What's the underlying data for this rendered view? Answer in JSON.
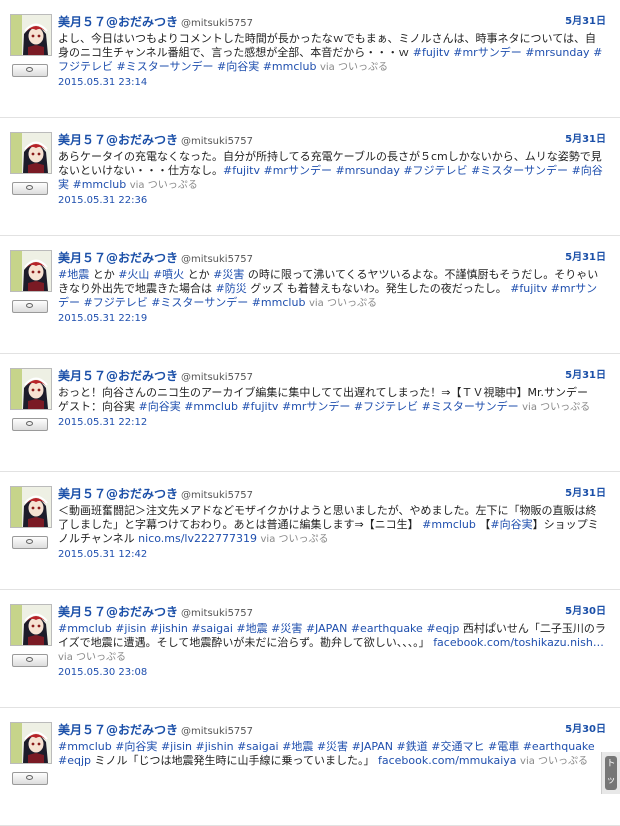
{
  "user": {
    "name": "美月５７@おだみつき",
    "handle": "@mitsuki5757"
  },
  "via": "via ついっぷる",
  "tweets": [
    {
      "date": "5月31日",
      "timestamp": "2015.05.31 23:14",
      "segments": [
        {
          "t": "text",
          "v": "よし、今日はいつもよりコメントした時間が長かったなｗでもまぁ、ミノルさんは、時事ネタについては、自身のニコ生チャンネル番組で、言った感想が全部、本音だから・・・ｗ "
        },
        {
          "t": "tag",
          "v": "#fujitv"
        },
        {
          "t": "text",
          "v": " "
        },
        {
          "t": "tag",
          "v": "#mrサンデー"
        },
        {
          "t": "text",
          "v": " "
        },
        {
          "t": "tag",
          "v": "#mrsunday"
        },
        {
          "t": "text",
          "v": " "
        },
        {
          "t": "tag",
          "v": "#フジテレビ"
        },
        {
          "t": "text",
          "v": " "
        },
        {
          "t": "tag",
          "v": "#ミスターサンデー"
        },
        {
          "t": "text",
          "v": " "
        },
        {
          "t": "tag",
          "v": "#向谷実"
        },
        {
          "t": "text",
          "v": " "
        },
        {
          "t": "tag",
          "v": "#mmclub"
        },
        {
          "t": "text",
          "v": " "
        }
      ]
    },
    {
      "date": "5月31日",
      "timestamp": "2015.05.31 22:36",
      "segments": [
        {
          "t": "text",
          "v": "あらケータイの充電なくなった。自分が所持してる充電ケーブルの長さが５cmしかないから、ムリな姿勢で見ないといけない・・・仕方なし。"
        },
        {
          "t": "tag",
          "v": "#fujitv"
        },
        {
          "t": "text",
          "v": " "
        },
        {
          "t": "tag",
          "v": "#mrサンデー"
        },
        {
          "t": "text",
          "v": " "
        },
        {
          "t": "tag",
          "v": "#mrsunday"
        },
        {
          "t": "text",
          "v": " "
        },
        {
          "t": "tag",
          "v": "#フジテレビ"
        },
        {
          "t": "text",
          "v": " "
        },
        {
          "t": "tag",
          "v": "#ミスターサンデー"
        },
        {
          "t": "text",
          "v": " "
        },
        {
          "t": "tag",
          "v": "#向谷実"
        },
        {
          "t": "text",
          "v": " "
        },
        {
          "t": "tag",
          "v": "#mmclub"
        },
        {
          "t": "text",
          "v": " "
        }
      ]
    },
    {
      "date": "5月31日",
      "timestamp": "2015.05.31 22:19",
      "segments": [
        {
          "t": "tag",
          "v": "#地震"
        },
        {
          "t": "text",
          "v": " とか "
        },
        {
          "t": "tag",
          "v": "#火山"
        },
        {
          "t": "text",
          "v": " "
        },
        {
          "t": "tag",
          "v": "#噴火"
        },
        {
          "t": "text",
          "v": " とか "
        },
        {
          "t": "tag",
          "v": "#災害"
        },
        {
          "t": "text",
          "v": " の時に限って沸いてくるヤツいるよな。不謹慎厨もそうだし。そりゃいきなり外出先で地震きた場合は "
        },
        {
          "t": "tag",
          "v": "#防災"
        },
        {
          "t": "text",
          "v": " グッズ も着替えもないわ。発生したの夜だったし。 "
        },
        {
          "t": "tag",
          "v": "#fujitv"
        },
        {
          "t": "text",
          "v": " "
        },
        {
          "t": "tag",
          "v": "#mrサンデー"
        },
        {
          "t": "text",
          "v": " "
        },
        {
          "t": "tag",
          "v": "#フジテレビ"
        },
        {
          "t": "text",
          "v": " "
        },
        {
          "t": "tag",
          "v": "#ミスターサンデー"
        },
        {
          "t": "text",
          "v": " "
        },
        {
          "t": "tag",
          "v": "#mmclub"
        },
        {
          "t": "text",
          "v": " "
        }
      ]
    },
    {
      "date": "5月31日",
      "timestamp": "2015.05.31 22:12",
      "segments": [
        {
          "t": "text",
          "v": "おっと！向谷さんのニコ生のアーカイブ編集に集中してて出遅れてしまった！⇒【ＴＶ視聴中】Mr.サンデー　ゲスト：向谷実 "
        },
        {
          "t": "tag",
          "v": "#向谷実"
        },
        {
          "t": "text",
          "v": " "
        },
        {
          "t": "tag",
          "v": "#mmclub"
        },
        {
          "t": "text",
          "v": "  "
        },
        {
          "t": "tag",
          "v": "#fujitv"
        },
        {
          "t": "text",
          "v": " "
        },
        {
          "t": "tag",
          "v": "#mrサンデー"
        },
        {
          "t": "text",
          "v": " "
        },
        {
          "t": "tag",
          "v": "#フジテレビ"
        },
        {
          "t": "text",
          "v": " "
        },
        {
          "t": "tag",
          "v": "#ミスターサンデー"
        },
        {
          "t": "text",
          "v": " "
        }
      ]
    },
    {
      "date": "5月31日",
      "timestamp": "2015.05.31 12:42",
      "segments": [
        {
          "t": "text",
          "v": "＜動画班奮闘記＞注文先メアドなどモザイクかけようと思いましたが、やめました。左下に「物販の直販は終了しました」と字幕つけておわり。あとは普通に編集します⇒【ニコ生】 "
        },
        {
          "t": "tag",
          "v": "#mmclub"
        },
        {
          "t": "text",
          "v": " 【"
        },
        {
          "t": "tag",
          "v": "#向谷実"
        },
        {
          "t": "text",
          "v": "】ショップミノルチャンネル "
        },
        {
          "t": "link",
          "v": "nico.ms/lv222777319"
        },
        {
          "t": "text",
          "v": " "
        }
      ]
    },
    {
      "date": "5月30日",
      "timestamp": "2015.05.30 23:08",
      "segments": [
        {
          "t": "tag",
          "v": "#mmclub"
        },
        {
          "t": "text",
          "v": " "
        },
        {
          "t": "tag",
          "v": "#jisin"
        },
        {
          "t": "text",
          "v": " "
        },
        {
          "t": "tag",
          "v": "#jishin"
        },
        {
          "t": "text",
          "v": " "
        },
        {
          "t": "tag",
          "v": "#saigai"
        },
        {
          "t": "text",
          "v": " "
        },
        {
          "t": "tag",
          "v": "#地震"
        },
        {
          "t": "text",
          "v": " "
        },
        {
          "t": "tag",
          "v": "#災害"
        },
        {
          "t": "text",
          "v": " "
        },
        {
          "t": "tag",
          "v": "#JAPAN"
        },
        {
          "t": "text",
          "v": " "
        },
        {
          "t": "tag",
          "v": "#earthquake"
        },
        {
          "t": "text",
          "v": " "
        },
        {
          "t": "tag",
          "v": "#eqjp"
        },
        {
          "t": "text",
          "v": " 西村ぱいせん「二子玉川のライズで地震に遭遇。そして地震酔いが未だに治らず。勘弁して欲しい、、、。」 "
        },
        {
          "t": "link",
          "v": "facebook.com/toshikazu.nish…"
        },
        {
          "t": "text",
          "v": " "
        }
      ]
    },
    {
      "date": "5月30日",
      "timestamp": "",
      "segments": [
        {
          "t": "tag",
          "v": "#mmclub"
        },
        {
          "t": "text",
          "v": " "
        },
        {
          "t": "tag",
          "v": "#向谷実"
        },
        {
          "t": "text",
          "v": "  "
        },
        {
          "t": "tag",
          "v": "#jisin"
        },
        {
          "t": "text",
          "v": " "
        },
        {
          "t": "tag",
          "v": "#jishin"
        },
        {
          "t": "text",
          "v": " "
        },
        {
          "t": "tag",
          "v": "#saigai"
        },
        {
          "t": "text",
          "v": " "
        },
        {
          "t": "tag",
          "v": "#地震"
        },
        {
          "t": "text",
          "v": " "
        },
        {
          "t": "tag",
          "v": "#災害"
        },
        {
          "t": "text",
          "v": " "
        },
        {
          "t": "tag",
          "v": "#JAPAN"
        },
        {
          "t": "text",
          "v": " "
        },
        {
          "t": "tag",
          "v": "#鉄道"
        },
        {
          "t": "text",
          "v": " "
        },
        {
          "t": "tag",
          "v": "#交通マヒ"
        },
        {
          "t": "text",
          "v": " "
        },
        {
          "t": "tag",
          "v": "#電車"
        },
        {
          "t": "text",
          "v": " "
        },
        {
          "t": "tag",
          "v": "#earthquake"
        },
        {
          "t": "text",
          "v": " "
        },
        {
          "t": "tag",
          "v": "#eqjp"
        },
        {
          "t": "text",
          "v": " ミノル「じつは地震発生時に山手線に乗っていました。」 "
        },
        {
          "t": "link",
          "v": "facebook.com/mmukaiya"
        },
        {
          "t": "text",
          "v": " "
        }
      ]
    }
  ],
  "scrollbar": {
    "label": "ト ッ"
  }
}
